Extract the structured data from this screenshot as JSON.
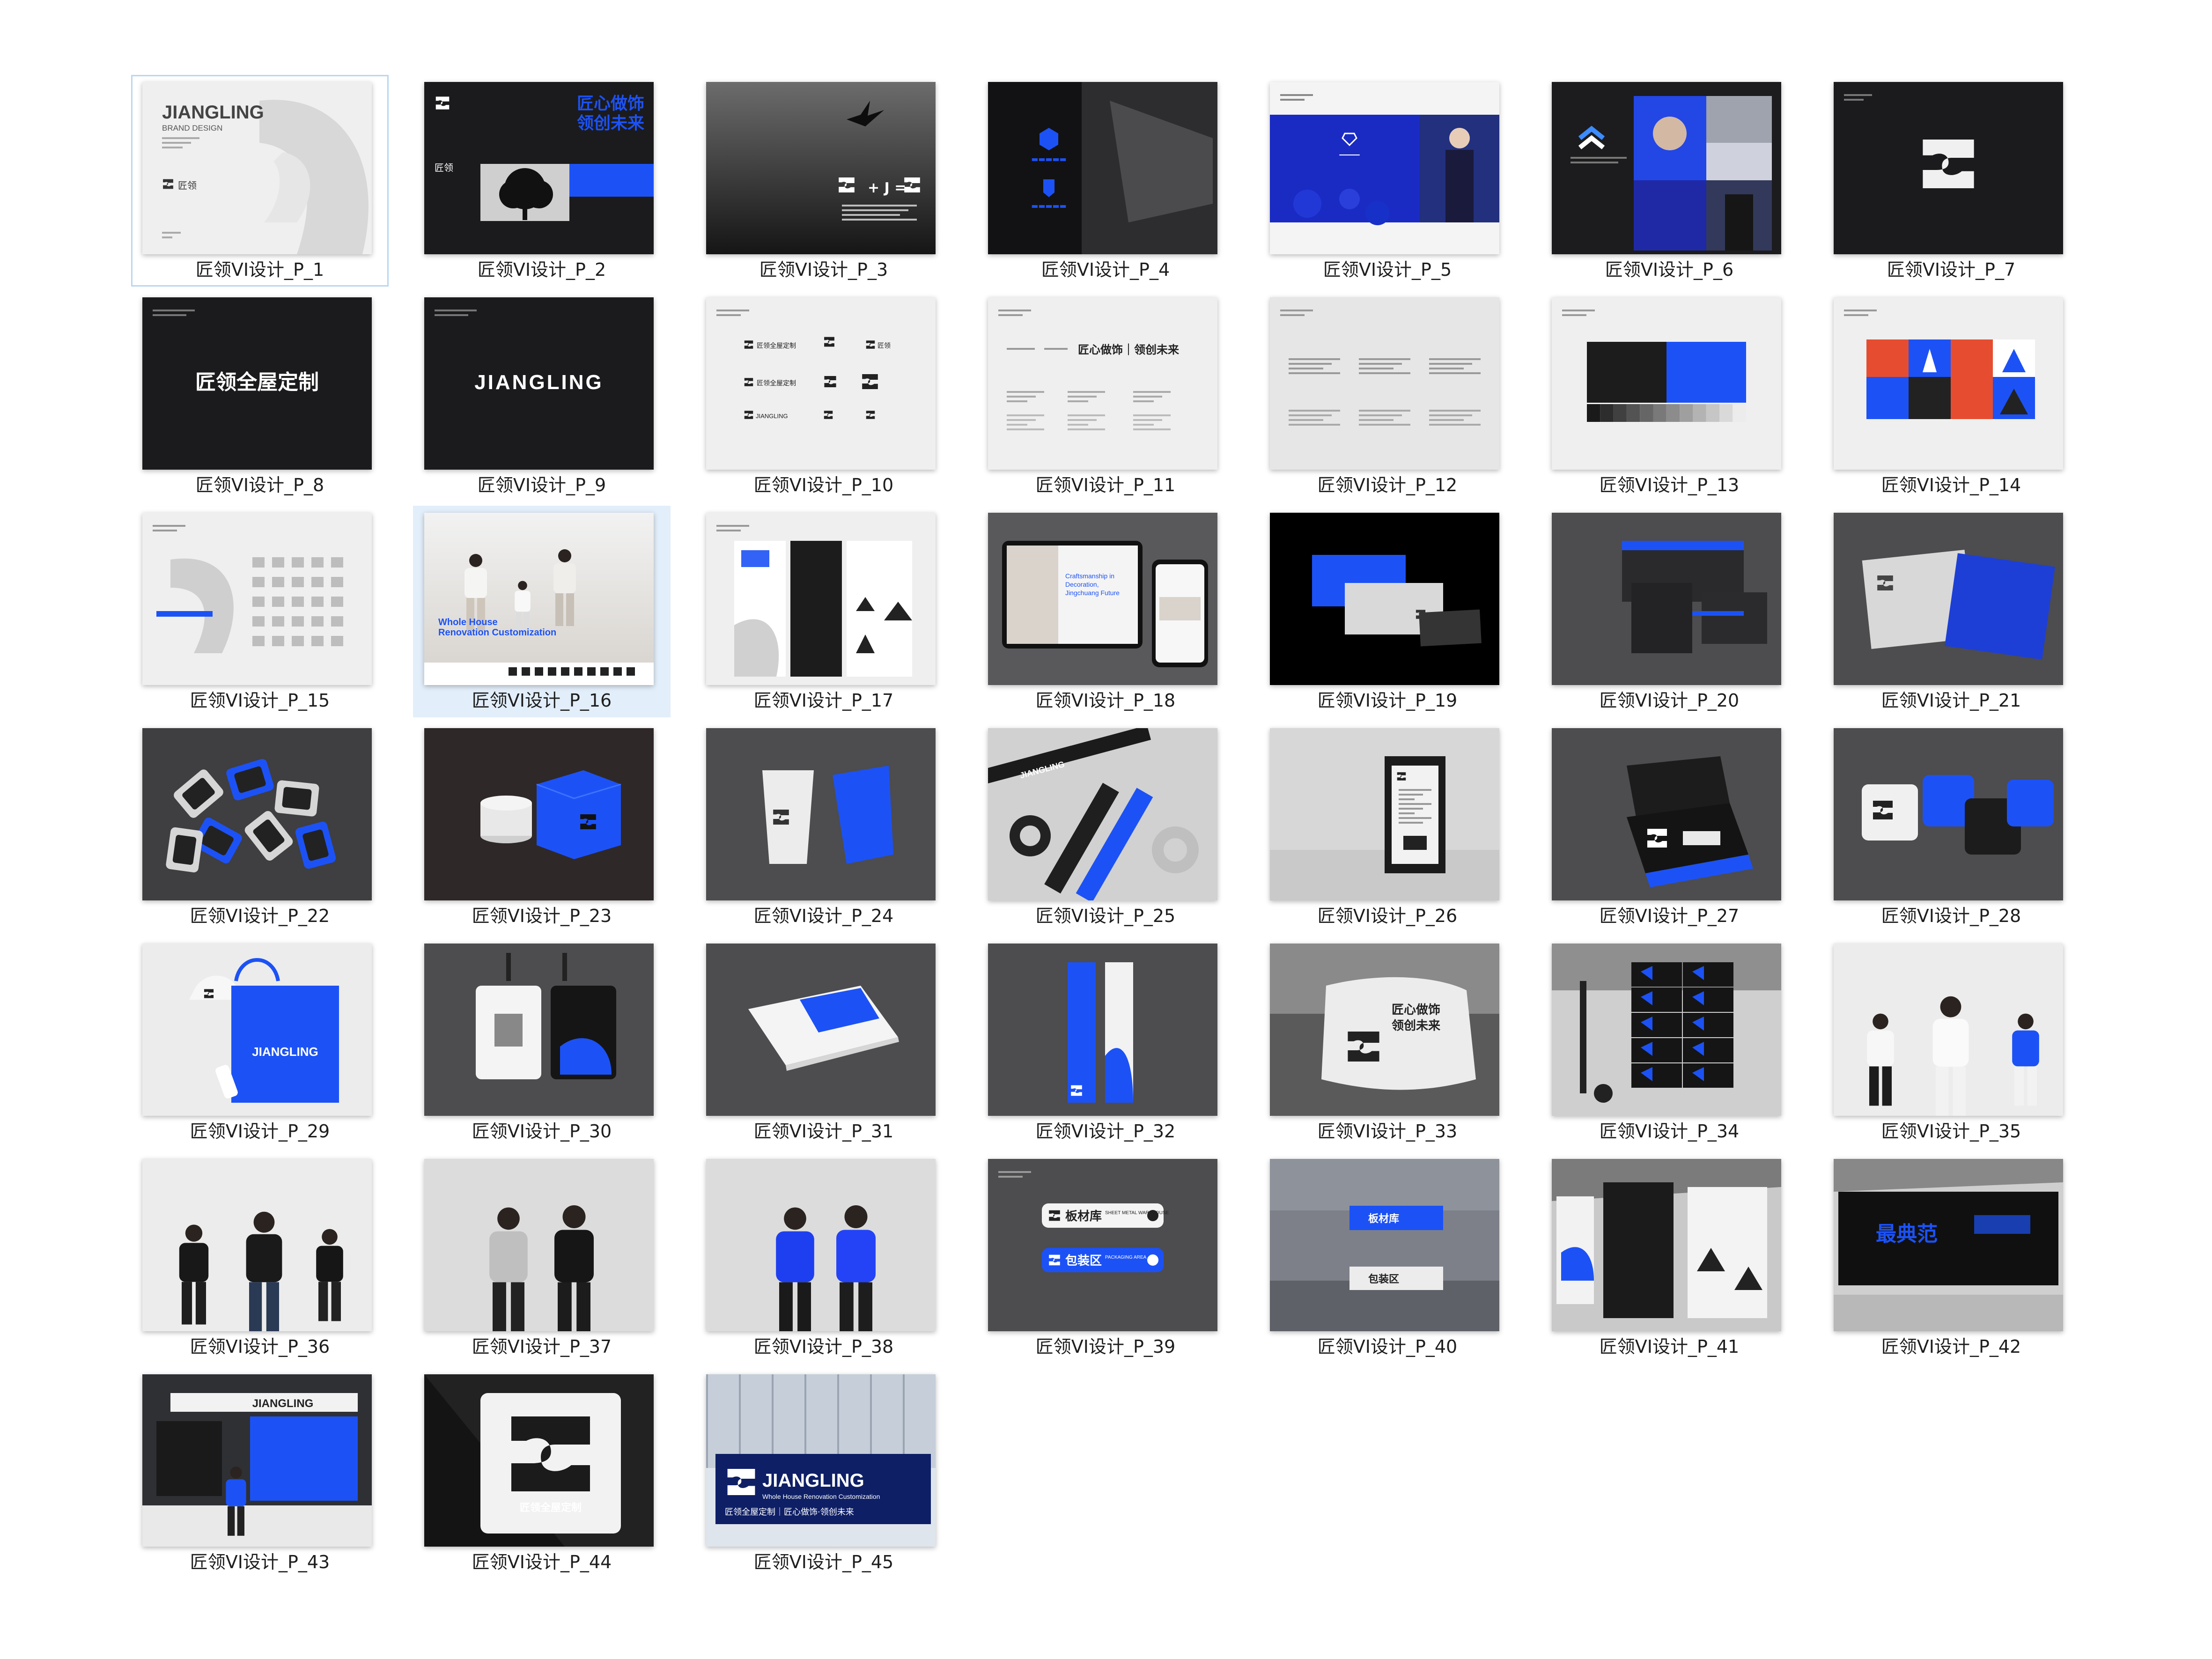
{
  "files": [
    {
      "label": "匠领VI设计_P_1",
      "theme": "light",
      "art": "cover",
      "texts": [
        "JIANGLING",
        "BRAND DESIGN",
        "匠领"
      ]
    },
    {
      "label": "匠领VI设计_P_2",
      "theme": "dark",
      "art": "slogan-tree",
      "texts": [
        "匠心做饰",
        "领创未来",
        "匠领"
      ]
    },
    {
      "label": "匠领VI设计_P_3",
      "theme": "grey",
      "art": "bird-formula",
      "texts": [
        "+ J ="
      ]
    },
    {
      "label": "匠领VI设计_P_4",
      "theme": "dark",
      "art": "photo-dark",
      "texts": []
    },
    {
      "label": "匠领VI设计_P_5",
      "theme": "light",
      "art": "blue-panel",
      "texts": []
    },
    {
      "label": "匠领VI设计_P_6",
      "theme": "dark",
      "art": "collage",
      "texts": []
    },
    {
      "label": "匠领VI设计_P_7",
      "theme": "dark",
      "art": "logo-mark",
      "texts": []
    },
    {
      "label": "匠领VI设计_P_8",
      "theme": "dark",
      "art": "wordmark",
      "texts": [
        "匠领全屋定制"
      ]
    },
    {
      "label": "匠领VI设计_P_9",
      "theme": "dark",
      "art": "wordmark-en",
      "texts": [
        "JIANGLING"
      ]
    },
    {
      "label": "匠领VI设计_P_10",
      "theme": "light",
      "art": "logo-grid",
      "texts": [
        "匠领全屋定制",
        "匠领"
      ]
    },
    {
      "label": "匠领VI设计_P_11",
      "theme": "light",
      "art": "type-spec",
      "texts": [
        "匠心做饰｜领创未来"
      ]
    },
    {
      "label": "匠领VI设计_P_12",
      "theme": "light",
      "art": "lines-spec",
      "texts": []
    },
    {
      "label": "匠领VI设计_P_13",
      "theme": "light",
      "art": "color-spec",
      "texts": []
    },
    {
      "label": "匠领VI设计_P_14",
      "theme": "light",
      "art": "pattern",
      "texts": []
    },
    {
      "label": "匠领VI设计_P_15",
      "theme": "light",
      "art": "icons",
      "texts": []
    },
    {
      "label": "匠领VI设计_P_16",
      "theme": "photo",
      "art": "family",
      "texts": [
        "Whole House",
        "Renovation Customization"
      ]
    },
    {
      "label": "匠领VI设计_P_17",
      "theme": "light",
      "art": "posters",
      "texts": []
    },
    {
      "label": "匠领VI设计_P_18",
      "theme": "grey",
      "art": "devices",
      "texts": [
        "Craftsmanship in Decoration, Jingchuang Future"
      ]
    },
    {
      "label": "匠领VI设计_P_19",
      "theme": "black",
      "art": "cards",
      "texts": []
    },
    {
      "label": "匠领VI设计_P_20",
      "theme": "grey",
      "art": "envelopes",
      "texts": []
    },
    {
      "label": "匠领VI设计_P_21",
      "theme": "grey",
      "art": "folders",
      "texts": []
    },
    {
      "label": "匠领VI设计_P_22",
      "theme": "grey",
      "art": "badges",
      "texts": []
    },
    {
      "label": "匠领VI设计_P_23",
      "theme": "grey",
      "art": "candle-box",
      "texts": []
    },
    {
      "label": "匠领VI设计_P_24",
      "theme": "grey",
      "art": "cups",
      "texts": []
    },
    {
      "label": "匠领VI设计_P_25",
      "theme": "photo",
      "art": "tape",
      "texts": [
        "JIANGLING"
      ]
    },
    {
      "label": "匠领VI设计_P_26",
      "theme": "photo",
      "art": "certificate",
      "texts": []
    },
    {
      "label": "匠领VI设计_P_27",
      "theme": "grey",
      "art": "giftbox",
      "texts": []
    },
    {
      "label": "匠领VI设计_P_28",
      "theme": "grey",
      "art": "coasters",
      "texts": []
    },
    {
      "label": "匠领VI设计_P_29",
      "theme": "photo",
      "art": "tote",
      "texts": [
        "JIANGLING"
      ]
    },
    {
      "label": "匠领VI设计_P_30",
      "theme": "grey",
      "art": "id-cards",
      "texts": []
    },
    {
      "label": "匠领VI设计_P_31",
      "theme": "grey",
      "art": "album",
      "texts": []
    },
    {
      "label": "匠领VI设计_P_32",
      "theme": "grey",
      "art": "rollup",
      "texts": []
    },
    {
      "label": "匠领VI设计_P_33",
      "theme": "photo",
      "art": "pillow",
      "texts": [
        "匠心做饰",
        "领创未来"
      ]
    },
    {
      "label": "匠领VI设计_P_34",
      "theme": "photo",
      "art": "cartons",
      "texts": []
    },
    {
      "label": "匠领VI设计_P_35",
      "theme": "photo",
      "art": "uniform-white",
      "texts": []
    },
    {
      "label": "匠领VI设计_P_36",
      "theme": "photo",
      "art": "uniform-black",
      "texts": []
    },
    {
      "label": "匠领VI设计_P_37",
      "theme": "photo",
      "art": "jackets-grey",
      "texts": []
    },
    {
      "label": "匠领VI设计_P_38",
      "theme": "photo",
      "art": "jackets-blue",
      "texts": []
    },
    {
      "label": "匠领VI设计_P_39",
      "theme": "grey",
      "art": "signage",
      "texts": [
        "板材库",
        "SHEET METAL WAREHOUSE",
        "包装区",
        "PACKAGING AREA"
      ]
    },
    {
      "label": "匠领VI设计_P_40",
      "theme": "photo",
      "art": "factory-signs",
      "texts": [
        "板材库",
        "包装区"
      ]
    },
    {
      "label": "匠领VI设计_P_41",
      "theme": "photo",
      "art": "banners",
      "texts": []
    },
    {
      "label": "匠领VI设计_P_42",
      "theme": "photo",
      "art": "billboard",
      "texts": [
        "最典范"
      ]
    },
    {
      "label": "匠领VI设计_P_43",
      "theme": "dark",
      "art": "booth",
      "texts": [
        "JIANGLING"
      ]
    },
    {
      "label": "匠领VI设计_P_44",
      "theme": "dark",
      "art": "lightbox",
      "texts": [
        "匠领全屋定制"
      ]
    },
    {
      "label": "匠领VI设计_P_45",
      "theme": "photo",
      "art": "facade",
      "texts": [
        "JIANGLING",
        "Whole House Renovation Customization",
        "匠领全屋定制｜匠心做饰·领创未来"
      ]
    }
  ],
  "selected_index": 0,
  "hover_index": 15,
  "colors": {
    "brand_blue": "#1c52f5",
    "dark": "#1d1d1f",
    "grey": "#4a494b",
    "light": "#eeeeee",
    "selection_border": "#b9d7f0",
    "hover_fill": "#e2eefa"
  }
}
